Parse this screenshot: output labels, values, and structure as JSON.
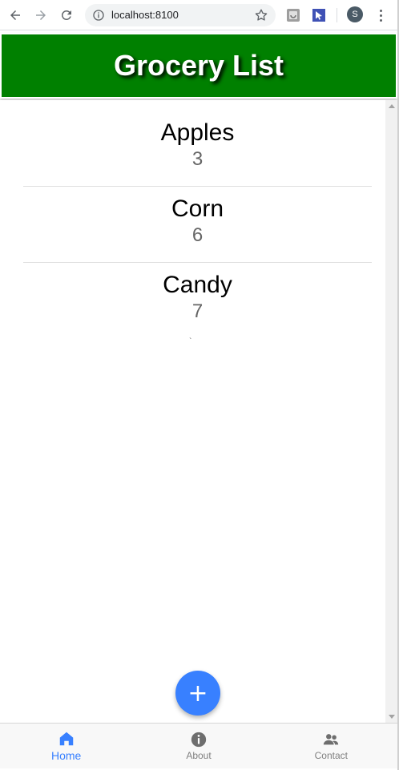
{
  "browser": {
    "url": "localhost:8100",
    "profile_initial": "S"
  },
  "header": {
    "title": "Grocery List",
    "bg_color": "#008000"
  },
  "list": {
    "items": [
      {
        "name": "Apples",
        "qty": "3"
      },
      {
        "name": "Corn",
        "qty": "6"
      },
      {
        "name": "Candy",
        "qty": "7"
      }
    ],
    "stray_mark": "`"
  },
  "fab": {
    "label": "+",
    "color": "#3880ff"
  },
  "tabs": [
    {
      "label": "Home",
      "icon": "home-icon",
      "active": true
    },
    {
      "label": "About",
      "icon": "info-icon",
      "active": false
    },
    {
      "label": "Contact",
      "icon": "people-icon",
      "active": false
    }
  ]
}
